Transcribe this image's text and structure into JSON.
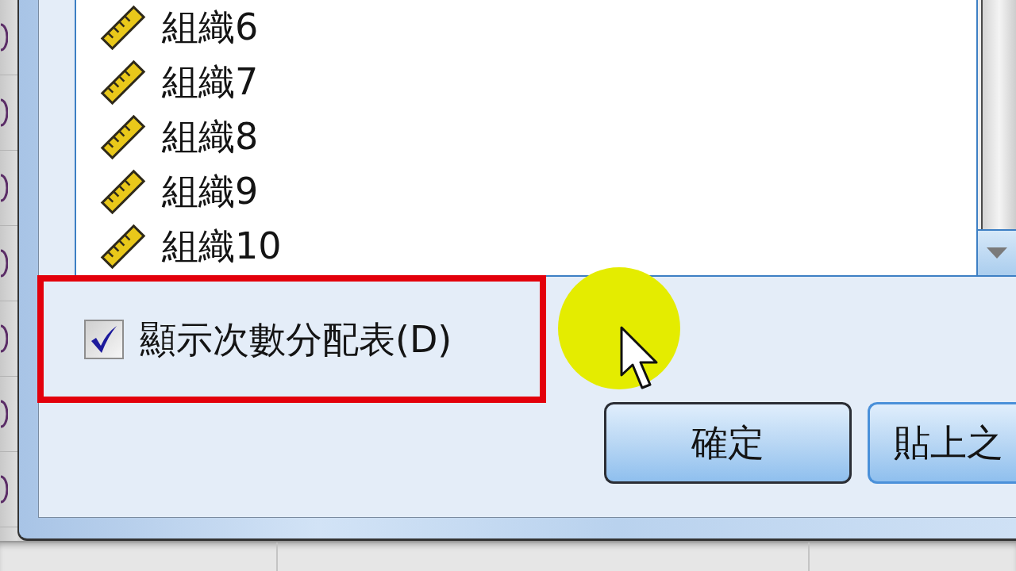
{
  "variable_list": {
    "items": [
      {
        "label": "組織6"
      },
      {
        "label": "組織7"
      },
      {
        "label": "組織8"
      },
      {
        "label": "組織9"
      },
      {
        "label": "組織10"
      }
    ]
  },
  "frequency_option": {
    "label": "顯示次數分配表(D)",
    "checked": true
  },
  "buttons": [
    {
      "label": "確定",
      "default": true
    },
    {
      "label": "貼上之",
      "default": false
    }
  ]
}
